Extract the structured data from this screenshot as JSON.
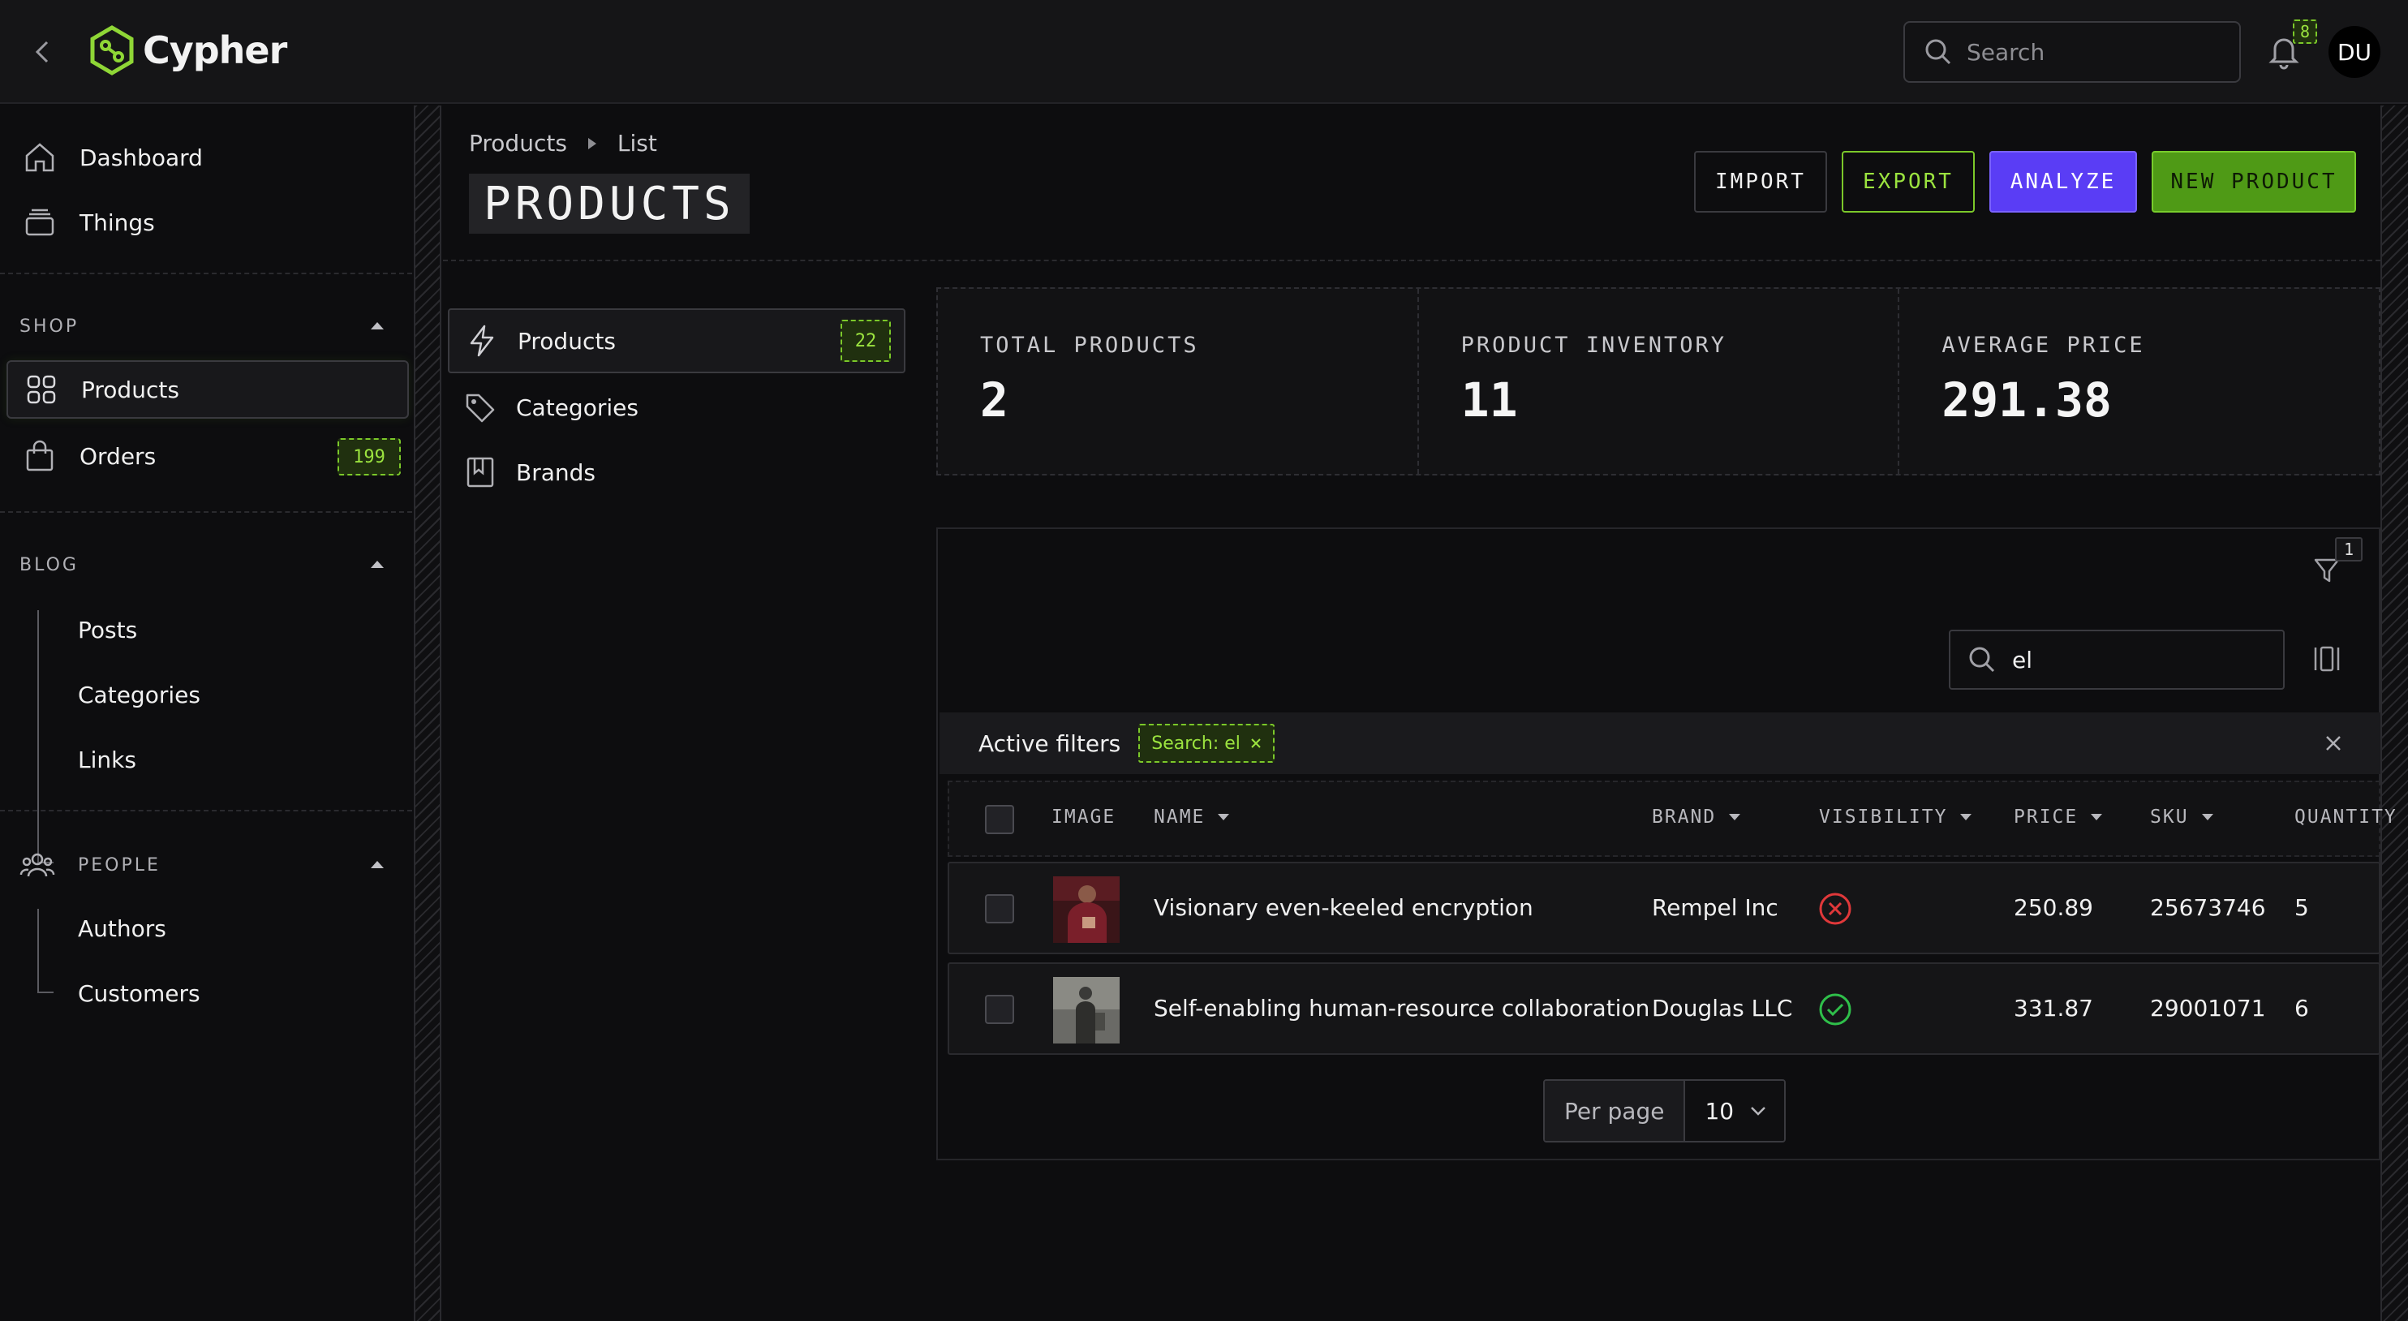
{
  "app": {
    "name": "Cypher"
  },
  "header": {
    "search_placeholder": "Search",
    "notifications_count": "8",
    "user_initials": "DU"
  },
  "sidebar": {
    "top_items": [
      {
        "label": "Dashboard",
        "icon": "home-icon"
      },
      {
        "label": "Things",
        "icon": "layers-icon"
      }
    ],
    "sections": [
      {
        "title": "SHOP",
        "items": [
          {
            "label": "Products",
            "icon": "grid-icon",
            "active": true
          },
          {
            "label": "Orders",
            "icon": "shopping-bag-icon",
            "badge": "199"
          }
        ]
      },
      {
        "title": "BLOG",
        "items": [
          {
            "label": "Posts"
          },
          {
            "label": "Categories"
          },
          {
            "label": "Links"
          }
        ]
      },
      {
        "title": "PEOPLE",
        "icon": "people-icon",
        "items": [
          {
            "label": "Authors"
          },
          {
            "label": "Customers"
          }
        ]
      }
    ]
  },
  "breadcrumb": [
    "Products",
    "List"
  ],
  "page_title": "PRODUCTS",
  "actions": {
    "import": "IMPORT",
    "export": "EXPORT",
    "analyze": "ANALYZE",
    "new_product": "NEW PRODUCT"
  },
  "subnav": [
    {
      "label": "Products",
      "icon": "bolt-icon",
      "badge": "22",
      "active": true
    },
    {
      "label": "Categories",
      "icon": "tag-icon"
    },
    {
      "label": "Brands",
      "icon": "bookmark-icon"
    }
  ],
  "stats": [
    {
      "label": "TOTAL PRODUCTS",
      "value": "2"
    },
    {
      "label": "PRODUCT INVENTORY",
      "value": "11"
    },
    {
      "label": "AVERAGE PRICE",
      "value": "291.38"
    }
  ],
  "table": {
    "filter_count": "1",
    "search_value": "el",
    "active_filters_label": "Active filters",
    "filters": [
      {
        "label": "Search: el"
      }
    ],
    "columns": [
      "IMAGE",
      "NAME",
      "BRAND",
      "VISIBILITY",
      "PRICE",
      "SKU",
      "QUANTITY"
    ],
    "rows": [
      {
        "name": "Visionary even-keeled encryption",
        "brand": "Rempel Inc",
        "visible": false,
        "price": "250.89",
        "sku": "25673746",
        "quantity": "5"
      },
      {
        "name": "Self-enabling human-resource collaboration",
        "brand": "Douglas LLC",
        "visible": true,
        "price": "331.87",
        "sku": "29001071",
        "quantity": "6"
      }
    ],
    "per_page_label": "Per page",
    "per_page_value": "10"
  },
  "colors": {
    "accent_green": "#7bc82a",
    "analyze_purple": "#5a3df5",
    "danger_red": "#e0383a",
    "success_green": "#2fbf4a"
  }
}
